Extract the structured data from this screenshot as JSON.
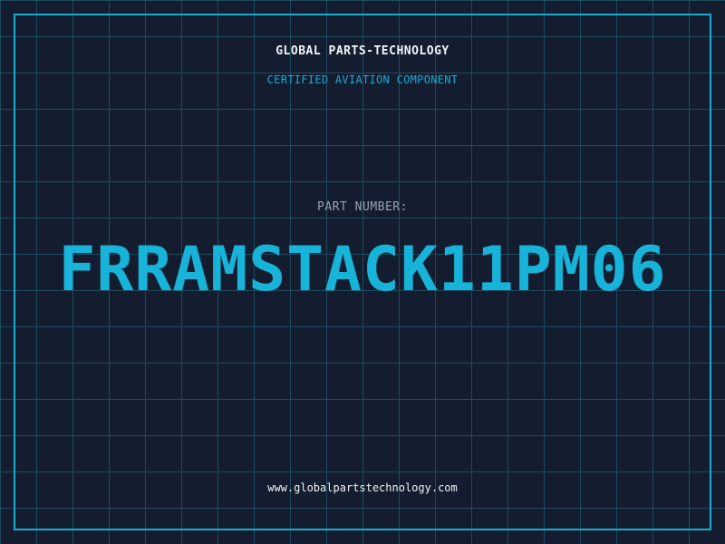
{
  "header": {
    "brand": "GLOBAL PARTS-TECHNOLOGY",
    "subtitle": "CERTIFIED AVIATION COMPONENT"
  },
  "main": {
    "part_label": "PART NUMBER:",
    "part_number": "FRRAMSTACK11PM06"
  },
  "footer": {
    "website": "www.globalpartstechnology.com"
  },
  "colors": {
    "background": "#141d30",
    "grid": "#1e4a5c",
    "accent": "#1aa9d1",
    "text": "#f2f5f8",
    "muted": "#9aa4b0"
  }
}
